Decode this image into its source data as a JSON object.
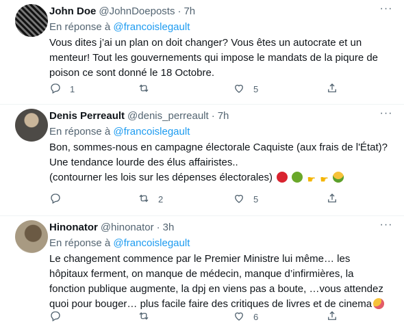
{
  "tweets": [
    {
      "name": "John Doe",
      "handle": "@JohnDoeposts",
      "dot": "·",
      "time": "7h",
      "reply_prefix": "En réponse à",
      "reply_mention": "@francoislegault",
      "text": "Vous dites j’ai un plan on doit changer? Vous êtes un autocrate et un menteur! Tout les gouvernements qui impose le mandats de la piqure de poison ce sont donné le 18 Octobre.",
      "replies": "1",
      "retweets": "",
      "likes": "5"
    },
    {
      "name": "Denis Perreault",
      "handle": "@denis_perreault",
      "dot": "·",
      "time": "7h",
      "reply_prefix": "En réponse à",
      "reply_mention": "@francoislegault",
      "text_lines": [
        "Bon, sommes-nous en campagne électorale Caquiste (aux frais de l'État)?",
        "Une tendance lourde des élus affairistes..",
        "(contourner les lois sur les dépenses électorales)"
      ],
      "replies": "",
      "retweets": "2",
      "likes": "5"
    },
    {
      "name": "Hinonator",
      "handle": "@hinonator",
      "dot": "·",
      "time": "3h",
      "reply_prefix": "En réponse à",
      "reply_mention": "@francoislegault",
      "text": "Le changement commence par le Premier Ministre lui même… les hôpitaux ferment, on manque de médecin, manque d’infirmières, la fonction publique augmente, la dpj en viens pas a boute, …vous attendez quoi pour bouger… plus facile faire des critiques de livres et de cinema",
      "replies": "",
      "retweets": "",
      "likes": "6"
    }
  ],
  "more_icon": "···",
  "colors": {
    "text": "#0f1419",
    "secondary": "#536471",
    "accent": "#1d9bf0",
    "divider": "#eff3f4"
  },
  "icons": [
    "reply-icon",
    "retweet-icon",
    "like-icon",
    "share-icon",
    "more-icon"
  ]
}
